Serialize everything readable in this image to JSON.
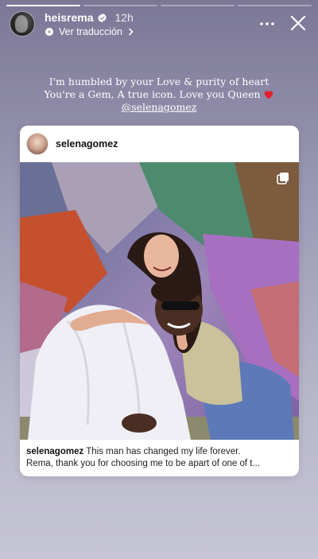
{
  "story": {
    "progress_segments": [
      1,
      1,
      1,
      1
    ],
    "active_segment": 0
  },
  "header": {
    "username": "heisrema",
    "verified": true,
    "time": "12h",
    "translate_label": "Ver traducción"
  },
  "caption": {
    "line1": "I'm humbled by your Love & purity of heart",
    "line2": "You're a Gem, A true icon. Love you Queen",
    "mention": "@selenagomez",
    "heart_color": "#e0202f"
  },
  "shared_post": {
    "username": "selenagomez",
    "caption_user": "selenagomez",
    "caption_line1": "This man has changed my life forever.",
    "caption_line2": "Rema, thank you for choosing me to be apart of one of t..."
  },
  "icons": {
    "verified": "verified-badge-icon",
    "more": "more-horizontal-icon",
    "close": "close-icon",
    "translate": "translate-globe-icon",
    "chevron": "chevron-right-icon",
    "carousel": "multiple-images-icon"
  }
}
